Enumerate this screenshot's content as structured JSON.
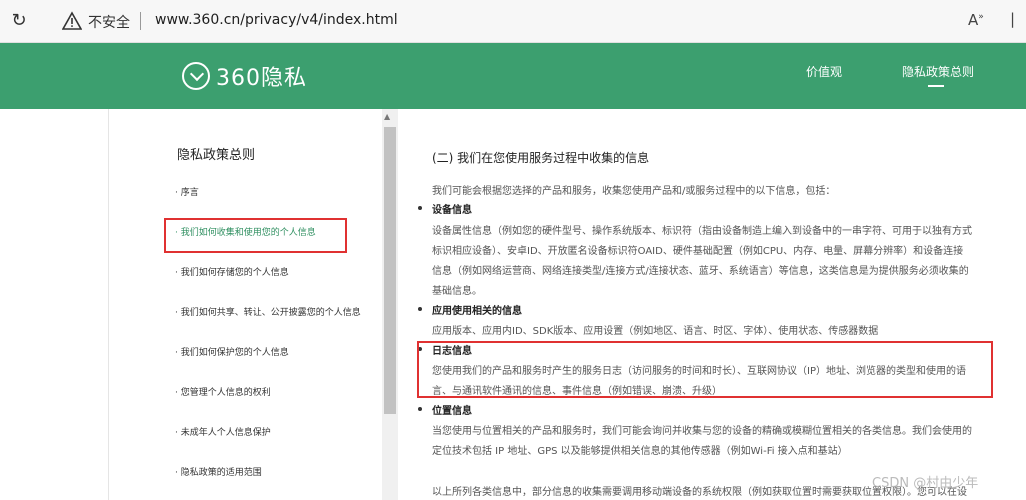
{
  "browser": {
    "security_label": "不安全",
    "url": "www.360.cn/privacy/v4/index.html",
    "read_aloud": "A",
    "more": "|"
  },
  "header": {
    "logo_text": "360隐私",
    "nav": [
      {
        "label": "价值观"
      },
      {
        "label": "隐私政策总则"
      }
    ],
    "color": "#3c9f6f"
  },
  "sidebar": {
    "title": "隐私政策总则",
    "items": [
      {
        "label": "· 序言"
      },
      {
        "label": "· 我们如何收集和使用您的个人信息"
      },
      {
        "label": "· 我们如何存储您的个人信息"
      },
      {
        "label": "· 我们如何共享、转让、公开披露您的个人信息"
      },
      {
        "label": "· 我们如何保护您的个人信息"
      },
      {
        "label": "· 您管理个人信息的权利"
      },
      {
        "label": "· 未成年人个人信息保护"
      },
      {
        "label": "· 隐私政策的适用范围"
      }
    ]
  },
  "content": {
    "section_title": "(二) 我们在您使用服务过程中收集的信息",
    "intro": "我们可能会根据您选择的产品和服务，收集您使用产品和/或服务过程中的以下信息，包括：",
    "device": {
      "title": "设备信息",
      "lines": [
        "设备属性信息（例如您的硬件型号、操作系统版本、标识符（指由设备制造上编入到设备中的一串字符、可用于以独有方式",
        "标识相应设备）、安卓ID、开放匿名设备标识符OAID、硬件基础配置（例如CPU、内存、电量、屏幕分辨率）和设备连接",
        "信息（例如网络运营商、网络连接类型/连接方式/连接状态、蓝牙、系统语言）等信息，这类信息是为提供服务必须收集的",
        "基础信息。"
      ]
    },
    "app": {
      "title": "应用使用相关的信息",
      "lines": [
        "应用版本、应用内ID、SDK版本、应用设置（例如地区、语言、时区、字体）、使用状态、传感器数据"
      ]
    },
    "log": {
      "title": "日志信息",
      "lines": [
        "您使用我们的产品和服务时产生的服务日志（访问服务的时间和时长）、互联网协议（IP）地址、浏览器的类型和使用的语",
        "言、与通讯软件通讯的信息、事件信息（例如错误、崩溃、升级）"
      ]
    },
    "location": {
      "title": "位置信息",
      "lines": [
        "当您使用与位置相关的产品和服务时，我们可能会询问并收集与您的设备的精确或模糊位置相关的各类信息。我们会使用的",
        "定位技术包括 IP 地址、GPS 以及能够提供相关信息的其他传感器（例如Wi-Fi 接入点和基站）"
      ]
    },
    "footer_line": "以上所列各类信息中，部分信息的收集需要调用移动端设备的系统权限（例如获取位置时需要获取位置权限）。您可以在设"
  },
  "watermark": "CSDN @村由少年"
}
